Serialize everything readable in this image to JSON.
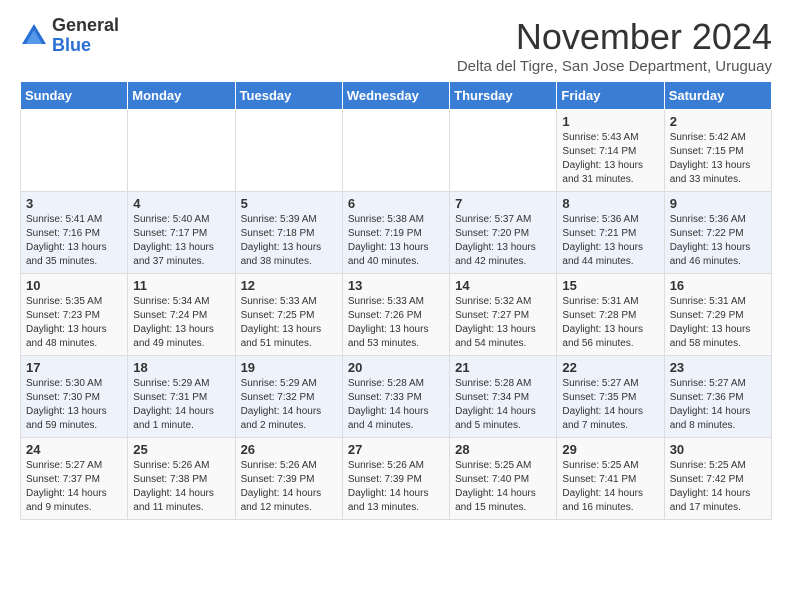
{
  "logo": {
    "general": "General",
    "blue": "Blue"
  },
  "header": {
    "month_title": "November 2024",
    "subtitle": "Delta del Tigre, San Jose Department, Uruguay"
  },
  "days_of_week": [
    "Sunday",
    "Monday",
    "Tuesday",
    "Wednesday",
    "Thursday",
    "Friday",
    "Saturday"
  ],
  "weeks": [
    [
      {
        "day": "",
        "info": ""
      },
      {
        "day": "",
        "info": ""
      },
      {
        "day": "",
        "info": ""
      },
      {
        "day": "",
        "info": ""
      },
      {
        "day": "",
        "info": ""
      },
      {
        "day": "1",
        "info": "Sunrise: 5:43 AM\nSunset: 7:14 PM\nDaylight: 13 hours and 31 minutes."
      },
      {
        "day": "2",
        "info": "Sunrise: 5:42 AM\nSunset: 7:15 PM\nDaylight: 13 hours and 33 minutes."
      }
    ],
    [
      {
        "day": "3",
        "info": "Sunrise: 5:41 AM\nSunset: 7:16 PM\nDaylight: 13 hours and 35 minutes."
      },
      {
        "day": "4",
        "info": "Sunrise: 5:40 AM\nSunset: 7:17 PM\nDaylight: 13 hours and 37 minutes."
      },
      {
        "day": "5",
        "info": "Sunrise: 5:39 AM\nSunset: 7:18 PM\nDaylight: 13 hours and 38 minutes."
      },
      {
        "day": "6",
        "info": "Sunrise: 5:38 AM\nSunset: 7:19 PM\nDaylight: 13 hours and 40 minutes."
      },
      {
        "day": "7",
        "info": "Sunrise: 5:37 AM\nSunset: 7:20 PM\nDaylight: 13 hours and 42 minutes."
      },
      {
        "day": "8",
        "info": "Sunrise: 5:36 AM\nSunset: 7:21 PM\nDaylight: 13 hours and 44 minutes."
      },
      {
        "day": "9",
        "info": "Sunrise: 5:36 AM\nSunset: 7:22 PM\nDaylight: 13 hours and 46 minutes."
      }
    ],
    [
      {
        "day": "10",
        "info": "Sunrise: 5:35 AM\nSunset: 7:23 PM\nDaylight: 13 hours and 48 minutes."
      },
      {
        "day": "11",
        "info": "Sunrise: 5:34 AM\nSunset: 7:24 PM\nDaylight: 13 hours and 49 minutes."
      },
      {
        "day": "12",
        "info": "Sunrise: 5:33 AM\nSunset: 7:25 PM\nDaylight: 13 hours and 51 minutes."
      },
      {
        "day": "13",
        "info": "Sunrise: 5:33 AM\nSunset: 7:26 PM\nDaylight: 13 hours and 53 minutes."
      },
      {
        "day": "14",
        "info": "Sunrise: 5:32 AM\nSunset: 7:27 PM\nDaylight: 13 hours and 54 minutes."
      },
      {
        "day": "15",
        "info": "Sunrise: 5:31 AM\nSunset: 7:28 PM\nDaylight: 13 hours and 56 minutes."
      },
      {
        "day": "16",
        "info": "Sunrise: 5:31 AM\nSunset: 7:29 PM\nDaylight: 13 hours and 58 minutes."
      }
    ],
    [
      {
        "day": "17",
        "info": "Sunrise: 5:30 AM\nSunset: 7:30 PM\nDaylight: 13 hours and 59 minutes."
      },
      {
        "day": "18",
        "info": "Sunrise: 5:29 AM\nSunset: 7:31 PM\nDaylight: 14 hours and 1 minute."
      },
      {
        "day": "19",
        "info": "Sunrise: 5:29 AM\nSunset: 7:32 PM\nDaylight: 14 hours and 2 minutes."
      },
      {
        "day": "20",
        "info": "Sunrise: 5:28 AM\nSunset: 7:33 PM\nDaylight: 14 hours and 4 minutes."
      },
      {
        "day": "21",
        "info": "Sunrise: 5:28 AM\nSunset: 7:34 PM\nDaylight: 14 hours and 5 minutes."
      },
      {
        "day": "22",
        "info": "Sunrise: 5:27 AM\nSunset: 7:35 PM\nDaylight: 14 hours and 7 minutes."
      },
      {
        "day": "23",
        "info": "Sunrise: 5:27 AM\nSunset: 7:36 PM\nDaylight: 14 hours and 8 minutes."
      }
    ],
    [
      {
        "day": "24",
        "info": "Sunrise: 5:27 AM\nSunset: 7:37 PM\nDaylight: 14 hours and 9 minutes."
      },
      {
        "day": "25",
        "info": "Sunrise: 5:26 AM\nSunset: 7:38 PM\nDaylight: 14 hours and 11 minutes."
      },
      {
        "day": "26",
        "info": "Sunrise: 5:26 AM\nSunset: 7:39 PM\nDaylight: 14 hours and 12 minutes."
      },
      {
        "day": "27",
        "info": "Sunrise: 5:26 AM\nSunset: 7:39 PM\nDaylight: 14 hours and 13 minutes."
      },
      {
        "day": "28",
        "info": "Sunrise: 5:25 AM\nSunset: 7:40 PM\nDaylight: 14 hours and 15 minutes."
      },
      {
        "day": "29",
        "info": "Sunrise: 5:25 AM\nSunset: 7:41 PM\nDaylight: 14 hours and 16 minutes."
      },
      {
        "day": "30",
        "info": "Sunrise: 5:25 AM\nSunset: 7:42 PM\nDaylight: 14 hours and 17 minutes."
      }
    ]
  ]
}
